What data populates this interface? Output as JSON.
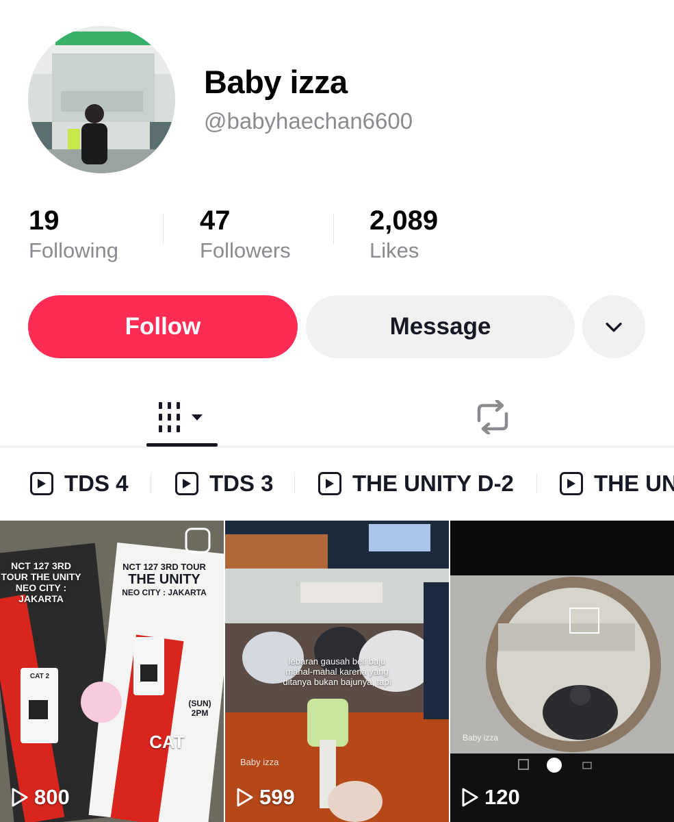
{
  "profile": {
    "name": "Baby izza",
    "handle": "@babyhaechan6600"
  },
  "stats": [
    {
      "value": "19",
      "label": "Following"
    },
    {
      "value": "47",
      "label": "Followers"
    },
    {
      "value": "2,089",
      "label": "Likes"
    }
  ],
  "actions": {
    "follow_label": "Follow",
    "message_label": "Message"
  },
  "colors": {
    "accent": "#fe2c55",
    "secondary_button": "#f1f1f2",
    "muted_text": "#8a8b91"
  },
  "tabs": [
    {
      "icon": "videos-grid-icon",
      "active": true
    },
    {
      "icon": "repost-icon",
      "active": false
    }
  ],
  "playlists": [
    {
      "title": "TDS 4",
      "icon": "playlist-icon"
    },
    {
      "title": "TDS 3",
      "icon": "playlist-icon"
    },
    {
      "title": "THE UNITY D-2",
      "icon": "playlist-icon"
    },
    {
      "title": "THE UN",
      "icon": "playlist-icon"
    }
  ],
  "videos": [
    {
      "views": "800",
      "texts": {
        "ticket_left": "NCT 127 3RD TOUR THE UNITY NEO CITY : JAKARTA",
        "ticket_right_l1": "NCT 127 3RD TOUR",
        "ticket_right_l2": "THE UNITY",
        "ticket_right_l3": "NEO CITY : JAKARTA",
        "band_left": "CAT 2",
        "band_right": "CAT",
        "band_time": "(SUN) 2PM"
      }
    },
    {
      "views": "599",
      "caption_l1": "lebaran gausah beli baju",
      "caption_l2": "mahal-mahal karena yang",
      "caption_l3": "ditanya bukan bajunya, tapi",
      "watermark": "Baby izza"
    },
    {
      "views": "120",
      "watermark": "Baby izza"
    }
  ]
}
